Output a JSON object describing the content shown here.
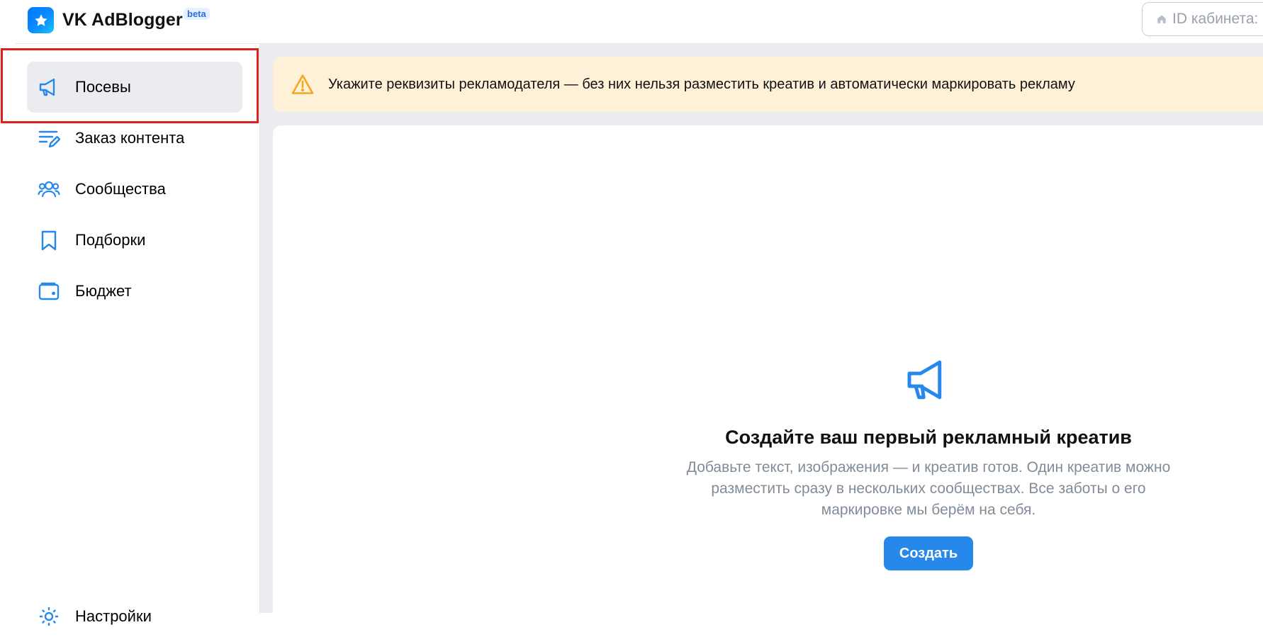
{
  "header": {
    "app_title": "VK AdBlogger",
    "beta_badge": "beta",
    "cabinet_placeholder": "ID кабинета:"
  },
  "sidebar": {
    "items": [
      {
        "label": "Посевы",
        "icon": "megaphone-icon",
        "active": true
      },
      {
        "label": "Заказ контента",
        "icon": "list-edit-icon",
        "active": false
      },
      {
        "label": "Сообщества",
        "icon": "users-icon",
        "active": false
      },
      {
        "label": "Подборки",
        "icon": "bookmark-icon",
        "active": false
      },
      {
        "label": "Бюджет",
        "icon": "wallet-icon",
        "active": false
      }
    ],
    "settings_label": "Настройки"
  },
  "banner": {
    "text": "Укажите реквизиты рекламодателя — без них нельзя разместить креатив и автоматически маркировать рекламу",
    "icon": "warning-icon"
  },
  "empty_state": {
    "icon": "megaphone-icon",
    "title": "Создайте ваш первый рекламный креатив",
    "description": "Добавьте текст, изображения — и креатив готов. Один креатив можно разместить сразу в нескольких сообществах. Все заботы о его маркировке мы берём на себя.",
    "button_label": "Создать"
  },
  "colors": {
    "accent": "#2688eb",
    "banner_bg": "#fff1d8",
    "warning": "#f5a623",
    "highlight_border": "#e0201c",
    "active_item_bg": "#ebecef"
  }
}
